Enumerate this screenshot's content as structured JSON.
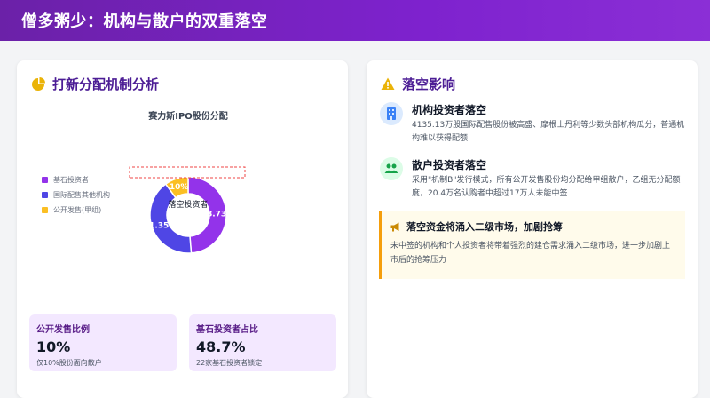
{
  "header": {
    "title": "僧多粥少：机构与散户的双重落空"
  },
  "left_card": {
    "title": "打新分配机制分析",
    "icon": "pie-chart-icon",
    "chart_title": "赛力斯IPO股份分配",
    "stats": [
      {
        "label": "公开发售比例",
        "value": "10%",
        "desc": "仅10%股份面向散户"
      },
      {
        "label": "基石投资者占比",
        "value": "48.7%",
        "desc": "22家基石投资者锁定"
      }
    ]
  },
  "chart_data": {
    "type": "pie",
    "title": "赛力斯IPO股份分配",
    "center_label": "落空投资者",
    "categories": [
      "基石投资者",
      "国际配售其他机构",
      "公开发售(甲组)"
    ],
    "values": [
      48.73,
      41.35,
      10
    ],
    "data_labels": [
      "48.73%",
      "41.35%",
      "10%"
    ],
    "colors": [
      "#9333ea",
      "#4f46e5",
      "#fbbf24"
    ],
    "legend": "left"
  },
  "right_card": {
    "title": "落空影响",
    "icon": "warning-icon",
    "items": [
      {
        "icon": "building-icon",
        "title": "机构投资者落空",
        "text": "4135.13万股国际配售股份被高盛、摩根士丹利等少数头部机构瓜分，普通机构难以获得配额"
      },
      {
        "icon": "users-icon",
        "title": "散户投资者落空",
        "text": "采用\"机制B\"发行模式，所有公开发售股份均分配给甲组散户，乙组无分配额度，20.4万名认购者中超过17万人未能中签"
      }
    ],
    "alert": {
      "icon": "megaphone-icon",
      "title": "落空资金将涌入二级市场，加剧抢筹",
      "text": "未中签的机构和个人投资者将带着强烈的建仓需求涌入二级市场，进一步加剧上市后的抢筹压力"
    }
  },
  "colors": {
    "accent": "#7e22ce",
    "stat_bg": "#f3e8ff",
    "alert_border": "#f59e0b"
  }
}
